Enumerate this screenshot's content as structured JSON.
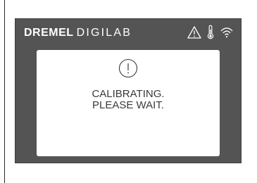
{
  "brand": {
    "bold": "DREMEL",
    "light": "DIGILAB"
  },
  "status_icons": [
    "warning-icon",
    "thermometer-icon",
    "wifi-icon"
  ],
  "dialog": {
    "icon": "info-circle-icon",
    "line1": "CALIBRATING.",
    "line2": "PLEASE WAIT."
  },
  "colors": {
    "screen_background": "#545454",
    "dialog_background": "#ffffff",
    "text": "#3a3a3a"
  }
}
